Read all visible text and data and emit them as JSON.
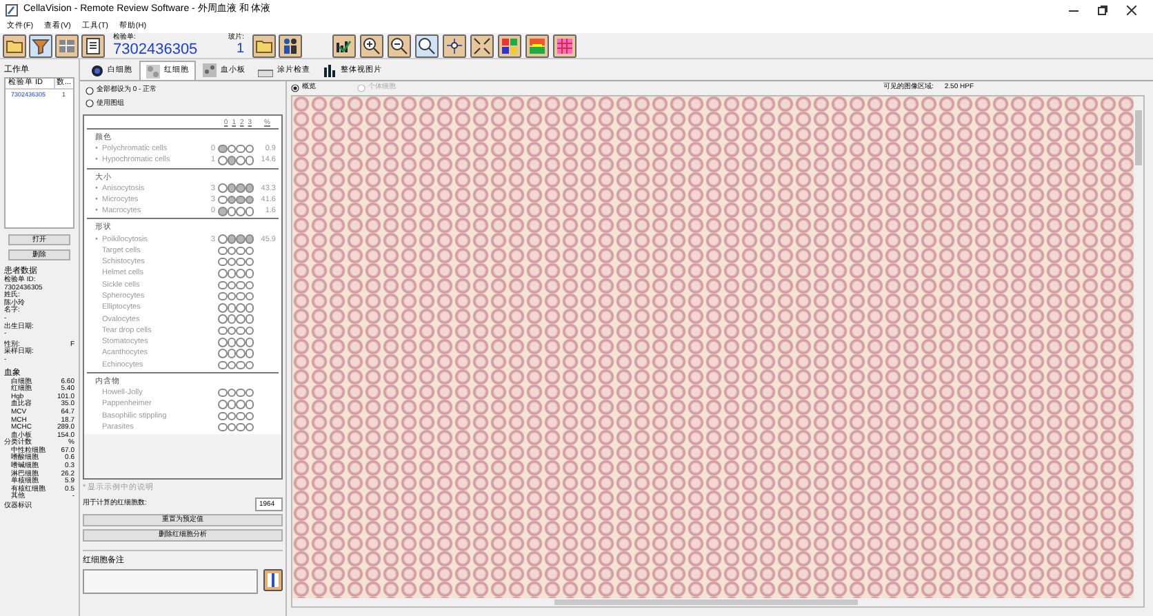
{
  "window": {
    "title": "CellaVision - Remote Review Software - 外周血液 和 体液"
  },
  "menu": [
    "文件(F)",
    "查看(V)",
    "工具(T)",
    "帮助(H)"
  ],
  "toolbar": {
    "order_label": "检验单:",
    "order_id": "7302436305",
    "slide_label": "玻片:",
    "slide_number": "1"
  },
  "worklist": {
    "title": "工作单",
    "columns": [
      "检验单 ID",
      "数..."
    ],
    "rows": [
      {
        "order_id": "7302436305",
        "count": "1",
        "selected": false
      }
    ],
    "buttons": [
      "打开",
      "删除"
    ]
  },
  "patient": {
    "title": "患者数据",
    "fields": [
      {
        "label": "检验单 ID:",
        "value": "7302436305",
        "kind": "block"
      },
      {
        "label": "姓氏:",
        "value": "陈小玲",
        "kind": "block"
      },
      {
        "label": "名字:",
        "value": "-",
        "kind": "block"
      },
      {
        "label": "出生日期:",
        "value": "-",
        "kind": "block"
      },
      {
        "label": "性别:",
        "value": "F",
        "kind": "inline"
      },
      {
        "label": "采样日期:",
        "value": "-",
        "kind": "block"
      }
    ],
    "blood_title": "血象",
    "blood": [
      {
        "label": "白细胞",
        "value": "6.60"
      },
      {
        "label": "红细胞",
        "value": "5.40"
      },
      {
        "label": "Hgb",
        "value": "101.0"
      },
      {
        "label": "血比容",
        "value": "35.0"
      },
      {
        "label": "MCV",
        "value": "64.7"
      },
      {
        "label": "MCH",
        "value": "18.7"
      },
      {
        "label": "MCHC",
        "value": "289.0"
      },
      {
        "label": "血小板",
        "value": "154.0"
      }
    ],
    "diff_title": "分类计数",
    "diff_unit": "%",
    "diff": [
      {
        "label": "中性粒细胞",
        "value": "67.0"
      },
      {
        "label": "嗜酸细胞",
        "value": "0.6"
      },
      {
        "label": "嗜碱细胞",
        "value": "0.3"
      },
      {
        "label": "淋巴细胞",
        "value": "26.2"
      },
      {
        "label": "单核细胞",
        "value": "5.9"
      },
      {
        "label": "有核红细胞",
        "value": "0.5"
      },
      {
        "label": "其他",
        "value": "-"
      }
    ],
    "instrument_label": "仪器标识"
  },
  "tabs": [
    {
      "label": "白细胞",
      "selected": false
    },
    {
      "label": "红细胞",
      "selected": true
    },
    {
      "label": "血小板",
      "selected": false
    },
    {
      "label": "涂片检查",
      "selected": false
    },
    {
      "label": "整体视图片",
      "selected": false
    }
  ],
  "rbc": {
    "options": [
      {
        "label": "全部都设为 0 - 正常",
        "selected": false
      },
      {
        "label": "使用图组",
        "selected": false
      }
    ],
    "grade_header": [
      "0",
      "1",
      "2",
      "3",
      "%"
    ],
    "groups": [
      {
        "title": "颜色",
        "items": [
          {
            "bullet": "•",
            "name": "Polychromatic cells",
            "grade": "0",
            "checked": [
              true,
              false,
              false,
              false
            ],
            "percent": "0.9"
          },
          {
            "bullet": "•",
            "name": "Hypochromatic cells",
            "grade": "1",
            "checked": [
              false,
              true,
              false,
              false
            ],
            "percent": "14.6"
          }
        ]
      },
      {
        "title": "大小",
        "items": [
          {
            "bullet": "•",
            "name": "Anisocytosis",
            "grade": "3",
            "checked": [
              false,
              true,
              true,
              true
            ],
            "percent": "43.3"
          },
          {
            "bullet": "•",
            "name": "Microcytes",
            "grade": "3",
            "checked": [
              false,
              true,
              true,
              true
            ],
            "percent": "41.6"
          },
          {
            "bullet": "•",
            "name": "Macrocytes",
            "grade": "0",
            "checked": [
              true,
              false,
              false,
              false
            ],
            "percent": "1.6"
          }
        ]
      },
      {
        "title": "形状",
        "items": [
          {
            "bullet": "•",
            "name": "Poikilocytosis",
            "grade": "3",
            "checked": [
              false,
              true,
              true,
              true
            ],
            "percent": "45.9"
          },
          {
            "name": "Target cells",
            "checked": [
              false,
              false,
              false,
              false
            ]
          },
          {
            "name": "Schistocytes",
            "checked": [
              false,
              false,
              false,
              false
            ]
          },
          {
            "name": "Helmet cells",
            "checked": [
              false,
              false,
              false,
              false
            ]
          },
          {
            "name": "Sickle cells",
            "checked": [
              false,
              false,
              false,
              false
            ]
          },
          {
            "name": "Spherocytes",
            "checked": [
              false,
              false,
              false,
              false
            ]
          },
          {
            "name": "Elliptocytes",
            "checked": [
              false,
              false,
              false,
              false
            ]
          },
          {
            "name": "Ovalocytes",
            "checked": [
              false,
              false,
              false,
              false
            ]
          },
          {
            "name": "Tear drop cells",
            "checked": [
              false,
              false,
              false,
              false
            ]
          },
          {
            "name": "Stomatocytes",
            "checked": [
              false,
              false,
              false,
              false
            ]
          },
          {
            "name": "Acanthocytes",
            "checked": [
              false,
              false,
              false,
              false
            ]
          },
          {
            "name": "Echinocytes",
            "checked": [
              false,
              false,
              false,
              false
            ]
          }
        ]
      },
      {
        "title": "内含物",
        "items": [
          {
            "name": "Howell-Jolly",
            "checked": [
              false,
              false,
              false,
              false
            ]
          },
          {
            "name": "Pappenheimer",
            "checked": [
              false,
              false,
              false,
              false
            ]
          },
          {
            "name": "Basophilic stippling",
            "checked": [
              false,
              false,
              false,
              false
            ]
          },
          {
            "name": "Parasites",
            "checked": [
              false,
              false,
              false,
              false
            ]
          }
        ]
      }
    ],
    "footnote": "* 显示示例中的说明",
    "count_label": "用于计算的红细胞数:",
    "count": "1964",
    "buttons": [
      "重置为预定值",
      "删除红细胞分析"
    ],
    "comment_title": "红细胞备注"
  },
  "viewer": {
    "modes": [
      {
        "label": "概览",
        "selected": true,
        "disabled": false
      },
      {
        "label": "个体细胞",
        "selected": false,
        "disabled": true
      }
    ],
    "area_label": "可见的图像区域:",
    "area_value": "2.50 HPF"
  }
}
